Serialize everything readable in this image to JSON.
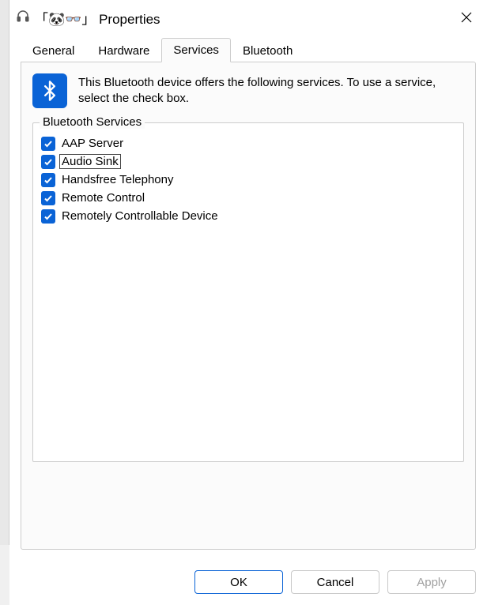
{
  "window": {
    "title_prefix": "「🐼👓」",
    "title_suffix": "Properties"
  },
  "tabs": {
    "general": "General",
    "hardware": "Hardware",
    "services": "Services",
    "bluetooth": "Bluetooth",
    "active": "services"
  },
  "info": {
    "text": "This Bluetooth device offers the following services. To use a service, select the check box."
  },
  "fieldset": {
    "legend": "Bluetooth Services"
  },
  "services": [
    {
      "label": "AAP Server",
      "checked": true,
      "focused": false
    },
    {
      "label": "Audio Sink",
      "checked": true,
      "focused": true
    },
    {
      "label": "Handsfree Telephony",
      "checked": true,
      "focused": false
    },
    {
      "label": "Remote Control",
      "checked": true,
      "focused": false
    },
    {
      "label": "Remotely Controllable Device",
      "checked": true,
      "focused": false
    }
  ],
  "buttons": {
    "ok": "OK",
    "cancel": "Cancel",
    "apply": "Apply"
  }
}
